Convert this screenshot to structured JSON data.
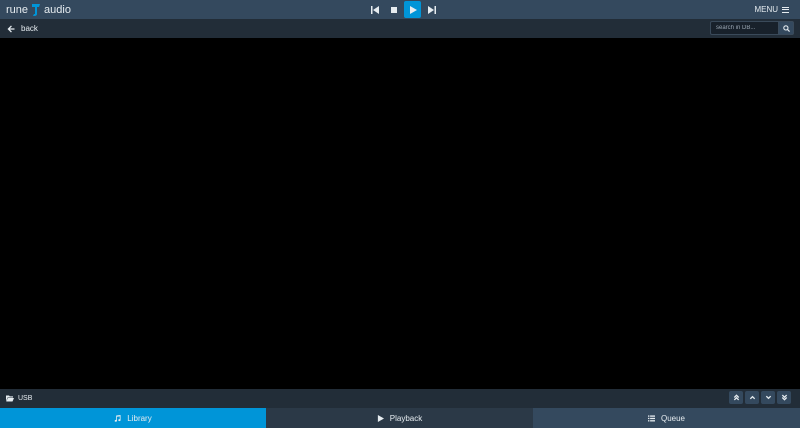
{
  "app": {
    "logo_left": "rune",
    "logo_right": "audio"
  },
  "transport": {
    "prev": "previous-icon",
    "stop": "stop-icon",
    "play": "play-icon",
    "next": "next-icon"
  },
  "menu": {
    "label": "MENU"
  },
  "subbar": {
    "back_label": "back"
  },
  "search": {
    "placeholder": "search in DB..."
  },
  "pathbar": {
    "path": "USB"
  },
  "tabs": [
    {
      "label": "Library",
      "icon": "music-note-icon",
      "active": true
    },
    {
      "label": "Playback",
      "icon": "play-icon",
      "active": false
    },
    {
      "label": "Queue",
      "icon": "list-icon",
      "active": false
    }
  ],
  "colors": {
    "accent": "#0095d8",
    "topbar": "#34495e",
    "subbar": "#222d38",
    "background": "#000000"
  }
}
